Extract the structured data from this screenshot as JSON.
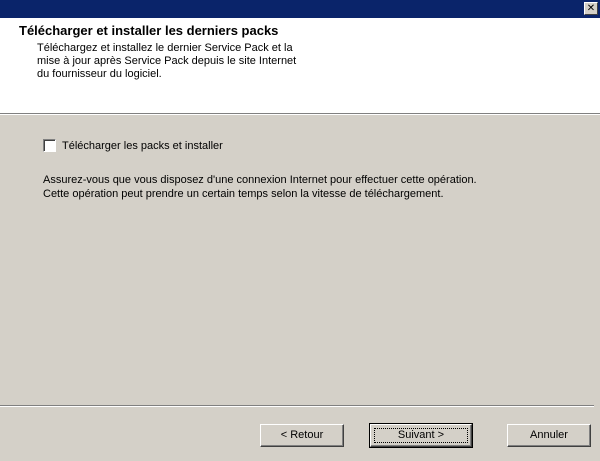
{
  "window": {
    "close_symbol": "✕"
  },
  "header": {
    "title": "Télécharger et installer les derniers packs",
    "description_lines": [
      "Téléchargez et installez le dernier Service Pack et la",
      "mise à jour après Service Pack depuis le site Internet",
      "du fournisseur du logiciel."
    ]
  },
  "body": {
    "checkbox_label": "Télécharger les packs et installer",
    "checkbox_checked": false,
    "info_lines": [
      "Assurez-vous que vous disposez d'une connexion Internet pour effectuer cette opération.",
      "Cette opération peut prendre un certain temps selon la vitesse de téléchargement."
    ]
  },
  "buttons": {
    "back": "< Retour",
    "next": "Suivant >",
    "cancel": "Annuler"
  },
  "colors": {
    "title_bar": "#0a246a",
    "dialog_bg": "#d4d0c8",
    "header_bg": "#ffffff"
  }
}
